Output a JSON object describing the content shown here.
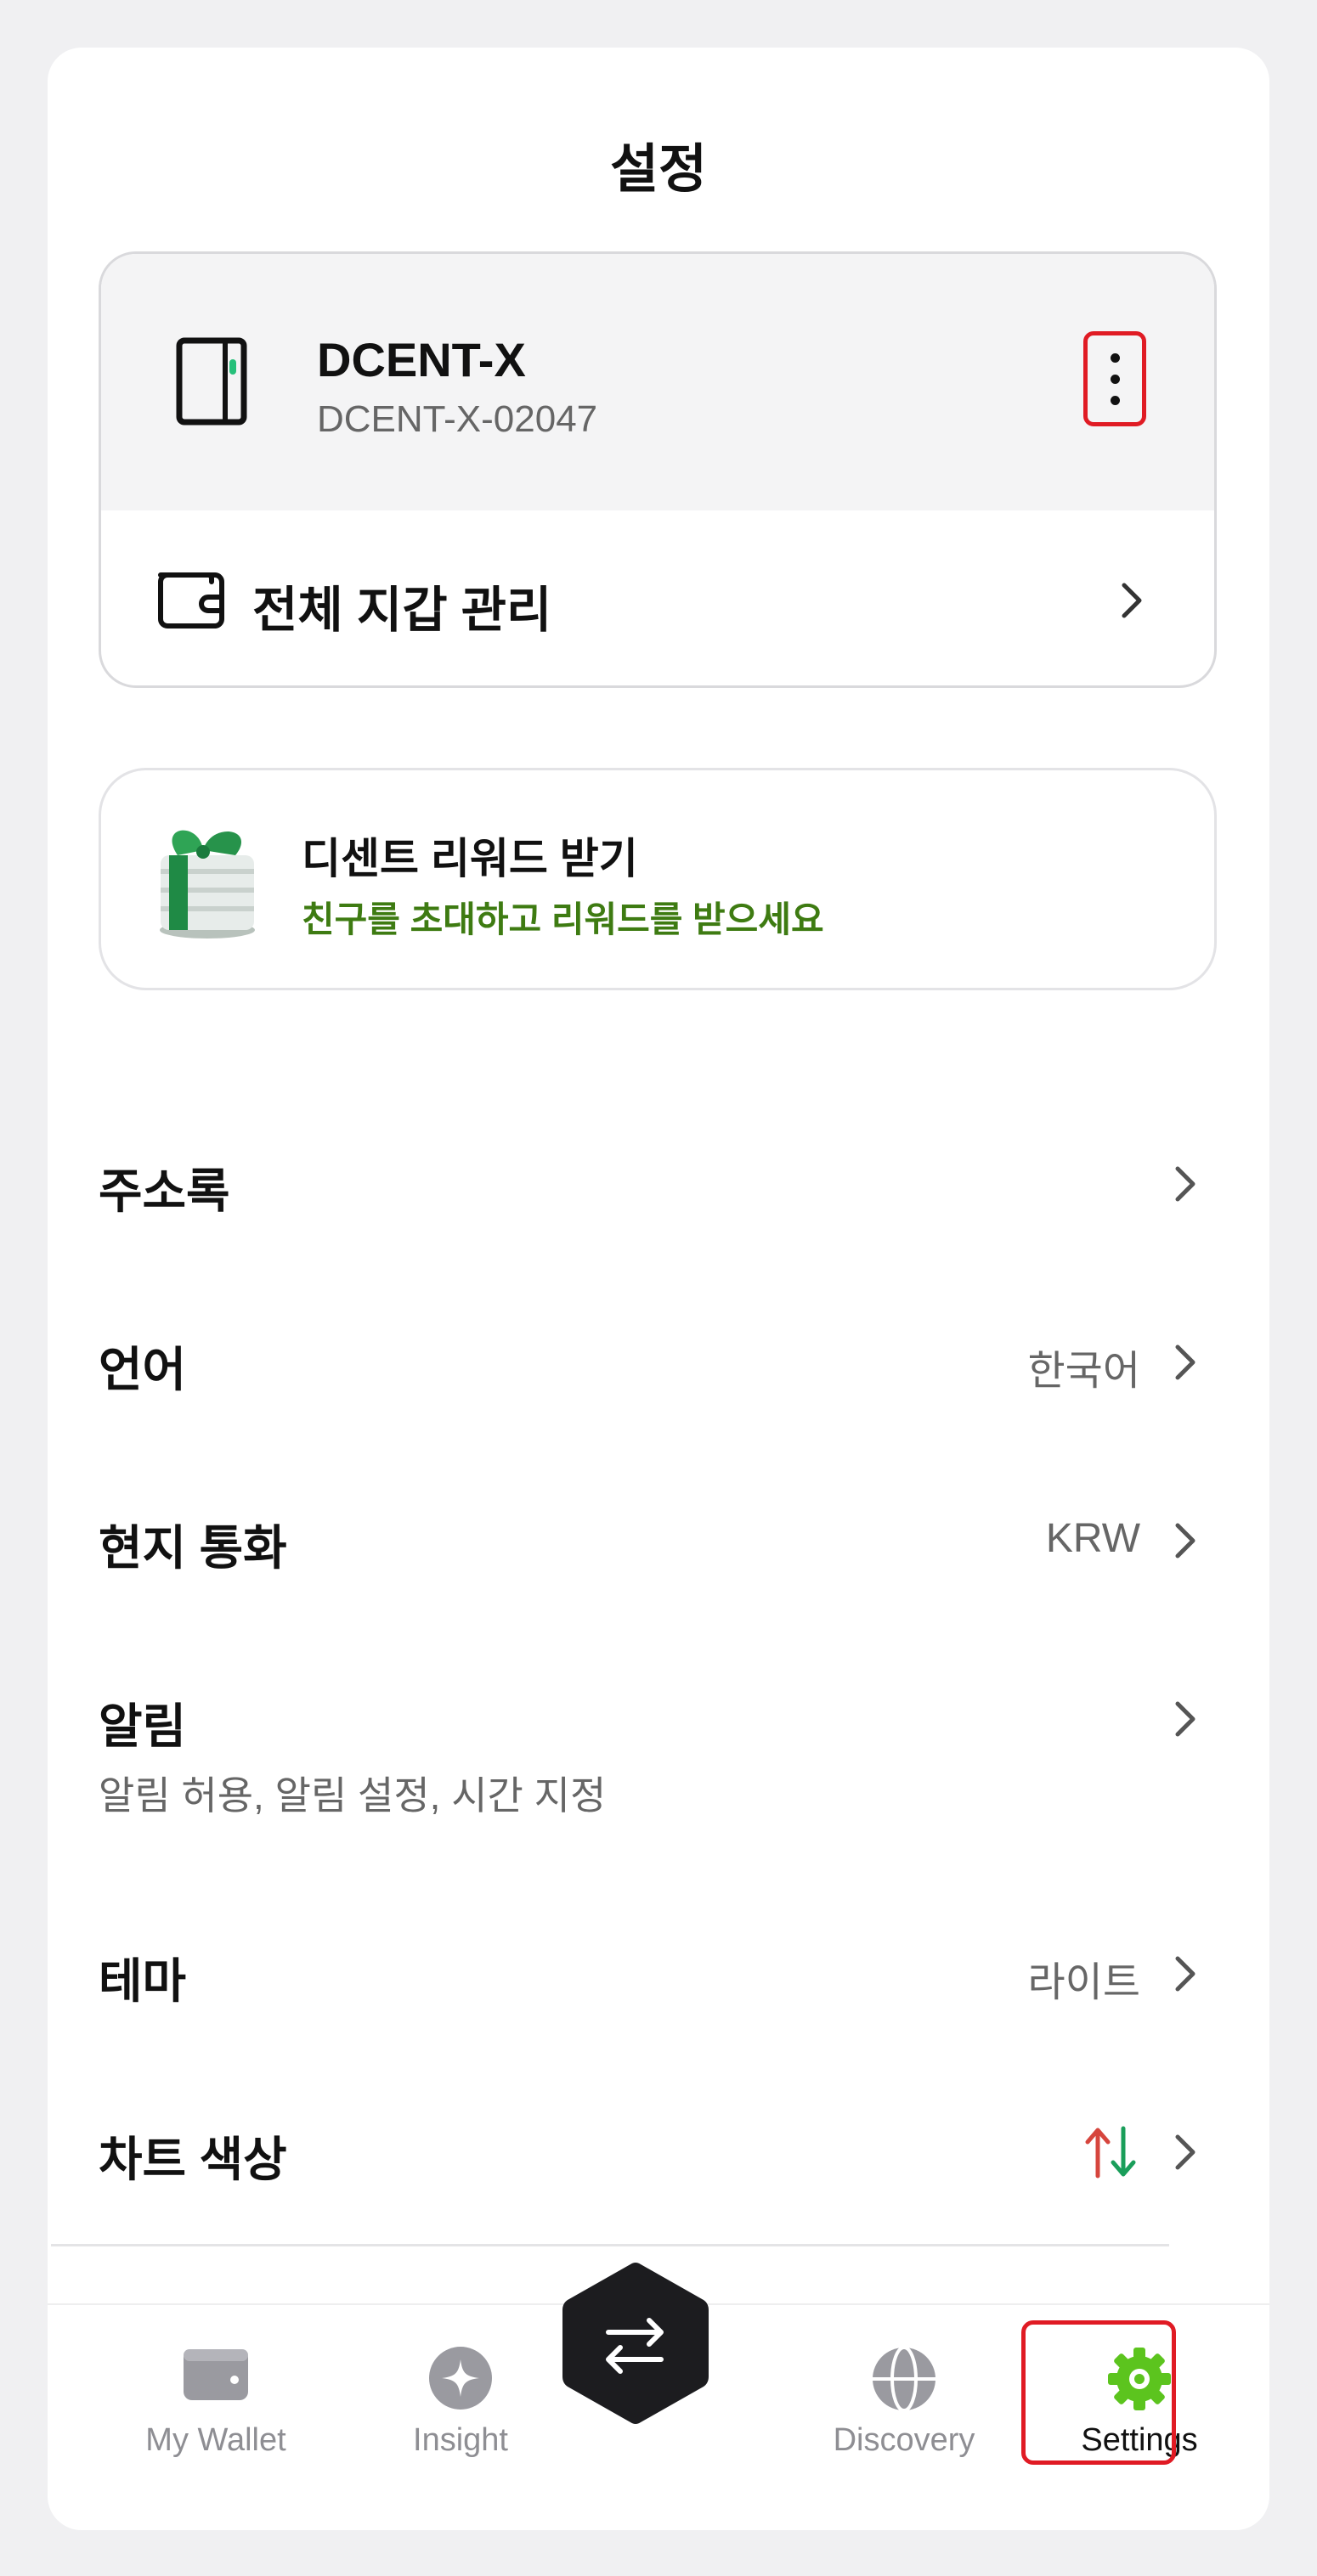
{
  "header": {
    "title": "설정"
  },
  "device": {
    "name": "DCENT-X",
    "serial": "DCENT-X-02047",
    "more_icon": "more-vertical-icon"
  },
  "wallet_manage": {
    "label": "전체 지갑 관리"
  },
  "reward": {
    "title": "디센트 리워드 받기",
    "subtitle": "친구를 초대하고 리워드를 받으세요"
  },
  "settings": {
    "address_book": {
      "label": "주소록"
    },
    "language": {
      "label": "언어",
      "value": "한국어"
    },
    "currency": {
      "label": "현지 통화",
      "value": "KRW"
    },
    "notifications": {
      "label": "알림",
      "sub": "알림 허용, 알림 설정, 시간 지정"
    },
    "theme": {
      "label": "테마",
      "value": "라이트"
    },
    "chart_color": {
      "label": "차트 색상",
      "up_color": "#d6453d",
      "down_color": "#1a9e5a"
    }
  },
  "nav": {
    "items": [
      {
        "label": "My Wallet",
        "icon": "wallet-icon"
      },
      {
        "label": "Insight",
        "icon": "sparkle-icon"
      },
      {
        "label": "",
        "icon": "swap-icon"
      },
      {
        "label": "Discovery",
        "icon": "globe-icon"
      },
      {
        "label": "Settings",
        "icon": "gear-icon"
      }
    ],
    "active": "Settings",
    "accent_color": "#5cc41e"
  }
}
